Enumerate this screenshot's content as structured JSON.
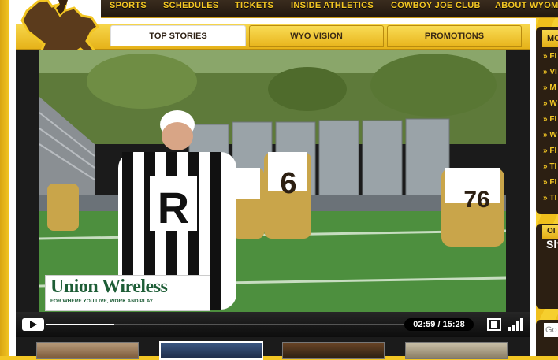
{
  "top_nav": {
    "items": [
      "SPORTS",
      "SCHEDULES",
      "TICKETS",
      "INSIDE ATHLETICS",
      "COWBOY JOE CLUB",
      "ABOUT WYOMI"
    ]
  },
  "tabs": [
    {
      "label": "TOP STORIES",
      "active": true
    },
    {
      "label": "WYO VISION",
      "active": false
    },
    {
      "label": "PROMOTIONS",
      "active": false
    }
  ],
  "video": {
    "ad_brand": "Union Wireless",
    "ad_tagline": "FOR WHERE YOU LIVE, WORK AND PLAY",
    "referee_letter": "R",
    "player_number_left": "6",
    "player_number_right": "76",
    "time_display": "02:59 / 15:28",
    "progress": 0.19
  },
  "thumbnails": [
    {
      "active": false
    },
    {
      "active": true
    },
    {
      "active": false
    },
    {
      "active": false
    }
  ],
  "sidebar": {
    "header": "MO",
    "items": [
      "» FI",
      "» VI",
      "» M",
      "» W",
      "» FI",
      "» W",
      "» FI",
      "» TI",
      "» FI",
      "» TI"
    ],
    "promo_header": "OI",
    "promo_text": "Sh",
    "search_placeholder": "Go"
  },
  "colors": {
    "gold": "#f3c623",
    "brown": "#2c1f12",
    "ad_green": "#1d5d36"
  }
}
